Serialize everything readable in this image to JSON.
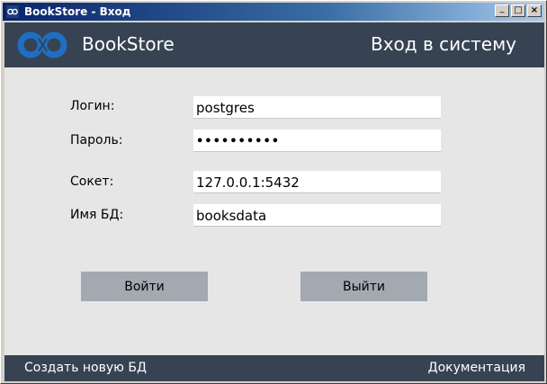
{
  "window": {
    "title": "BookStore - Вход"
  },
  "titlebar_buttons": {
    "minimize": "_",
    "maximize": "□",
    "close": "×"
  },
  "header": {
    "brand": "BookStore",
    "title": "Вход в систему"
  },
  "form": {
    "login_label": "Логин:",
    "login_value": "postgres",
    "password_label": "Пароль:",
    "password_value": "••••••••••",
    "socket_label": "Сокет:",
    "socket_value": "127.0.0.1:5432",
    "dbname_label": "Имя БД:",
    "dbname_value": "booksdata"
  },
  "buttons": {
    "login": "Войти",
    "exit": "Выйти"
  },
  "footer": {
    "create_db": "Создать новую БД",
    "docs": "Документация"
  },
  "colors": {
    "header_bg": "#374352",
    "client_bg": "#e6e6e6",
    "button_bg": "#a3a9b0",
    "logo_blue": "#1e6fc4",
    "titlebar_start": "#0a246a",
    "titlebar_end": "#a6caf0"
  },
  "icons": {
    "app_icon": "bookstore-logo-icon"
  }
}
